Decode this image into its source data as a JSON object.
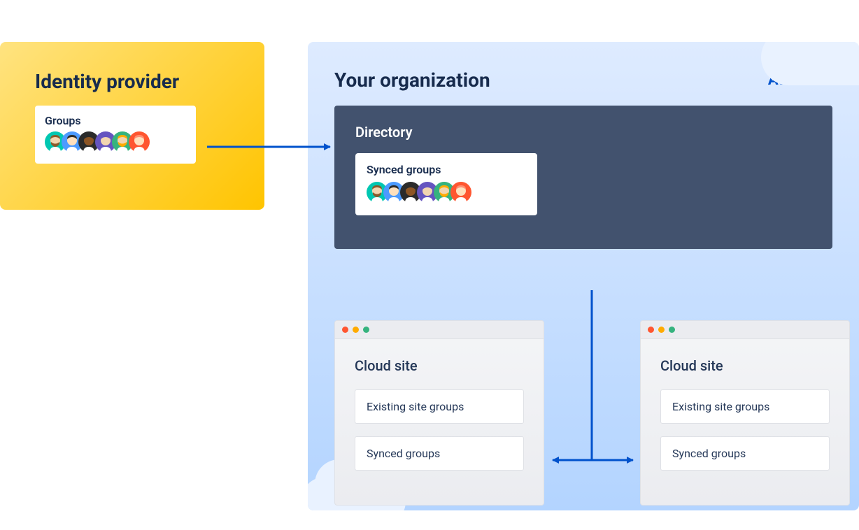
{
  "idp": {
    "title": "Identity provider",
    "groups_label": "Groups"
  },
  "org": {
    "title": "Your organization",
    "brand": "Atlassian",
    "directory": {
      "title": "Directory",
      "synced_label": "Synced groups"
    },
    "sites": [
      {
        "title": "Cloud site",
        "rows": [
          "Existing site groups",
          "Synced groups"
        ]
      },
      {
        "title": "Cloud site",
        "rows": [
          "Existing site groups",
          "Synced groups"
        ]
      }
    ]
  },
  "colors": {
    "arrow": "#0052CC"
  },
  "avatars": [
    {
      "bg": "#00C7B1",
      "face": "#F2D5B0",
      "hair": "#8B5A2B",
      "beard": true
    },
    {
      "bg": "#4C9AFF",
      "face": "#FFE0BD",
      "hair": "#2B2B2B",
      "beard": false
    },
    {
      "bg": "#2B2B2B",
      "face": "#8D5524",
      "hair": "#2B2B2B",
      "beard": false
    },
    {
      "bg": "#6554C0",
      "face": "#F2D5B0",
      "hair": "#6554C0",
      "beard": false
    },
    {
      "bg": "#36B37E",
      "face": "#F2D5B0",
      "hair": "#FFAB00",
      "beard": true
    },
    {
      "bg": "#FF5630",
      "face": "#FFE0BD",
      "hair": "#FF8F73",
      "beard": false
    }
  ]
}
